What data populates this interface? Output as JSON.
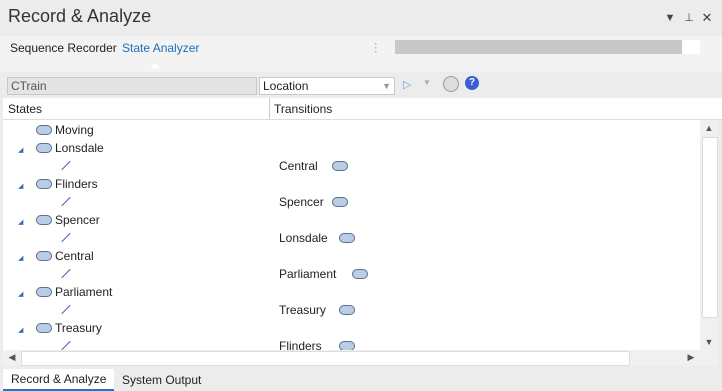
{
  "window": {
    "title": "Record & Analyze"
  },
  "tabs": [
    {
      "label": "Sequence Recorder"
    },
    {
      "label": "State Analyzer"
    }
  ],
  "progress": {
    "fraction": 0.94
  },
  "toolbar": {
    "class_name": "CTrain",
    "location_select": "Location"
  },
  "columns": {
    "states": "States",
    "transitions": "Transitions"
  },
  "tree": {
    "root_state": "Moving",
    "rows": [
      {
        "state": "Lonsdale",
        "transition": "Central"
      },
      {
        "state": "Flinders",
        "transition": "Spencer"
      },
      {
        "state": "Spencer",
        "transition": "Lonsdale"
      },
      {
        "state": "Central",
        "transition": "Parliament"
      },
      {
        "state": "Parliament",
        "transition": "Treasury"
      },
      {
        "state": "Treasury",
        "transition": "Flinders"
      }
    ]
  },
  "bottom_tabs": [
    {
      "label": "Record & Analyze"
    },
    {
      "label": "System Output"
    }
  ]
}
